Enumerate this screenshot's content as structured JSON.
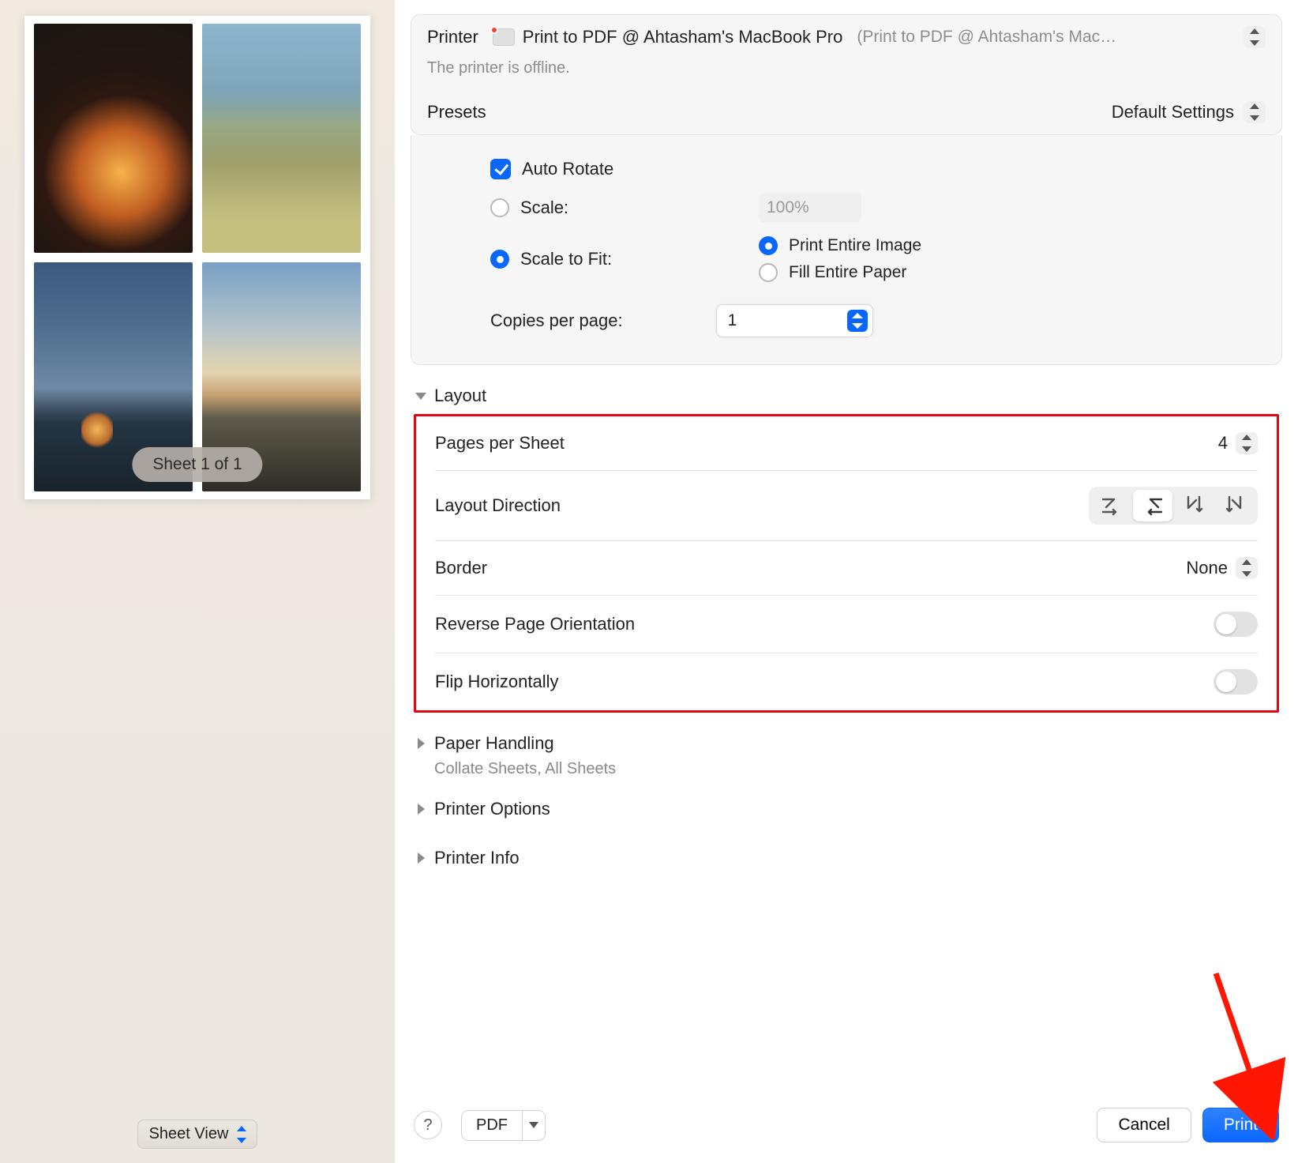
{
  "left": {
    "sheet_badge": "Sheet 1 of 1",
    "sheet_view_label": "Sheet View"
  },
  "printer": {
    "label": "Printer",
    "name": "Print to PDF @ Ahtasham's MacBook Pro",
    "detail": "(Print to PDF @ Ahtasham's Mac…",
    "offline_msg": "The printer is offline."
  },
  "presets": {
    "label": "Presets",
    "value": "Default Settings"
  },
  "scaling": {
    "auto_rotate": "Auto Rotate",
    "scale": "Scale:",
    "scale_value": "100%",
    "scale_to_fit": "Scale to Fit:",
    "print_entire": "Print Entire Image",
    "fill_entire": "Fill Entire Paper",
    "copies_label": "Copies per page:",
    "copies_value": "1"
  },
  "sections": {
    "layout": "Layout",
    "paper_handling": "Paper Handling",
    "paper_handling_sub": "Collate Sheets, All Sheets",
    "printer_options": "Printer Options",
    "printer_info": "Printer Info"
  },
  "layout": {
    "pages_per_sheet": {
      "label": "Pages per Sheet",
      "value": "4"
    },
    "layout_direction": "Layout Direction",
    "direction_options": [
      "Z",
      "Ƶ",
      "И",
      "N"
    ],
    "direction_selected_index": 1,
    "border": {
      "label": "Border",
      "value": "None"
    },
    "reverse": "Reverse Page Orientation",
    "flip": "Flip Horizontally",
    "reverse_on": false,
    "flip_on": false
  },
  "footer": {
    "help": "?",
    "pdf": "PDF",
    "cancel": "Cancel",
    "print": "Print"
  }
}
